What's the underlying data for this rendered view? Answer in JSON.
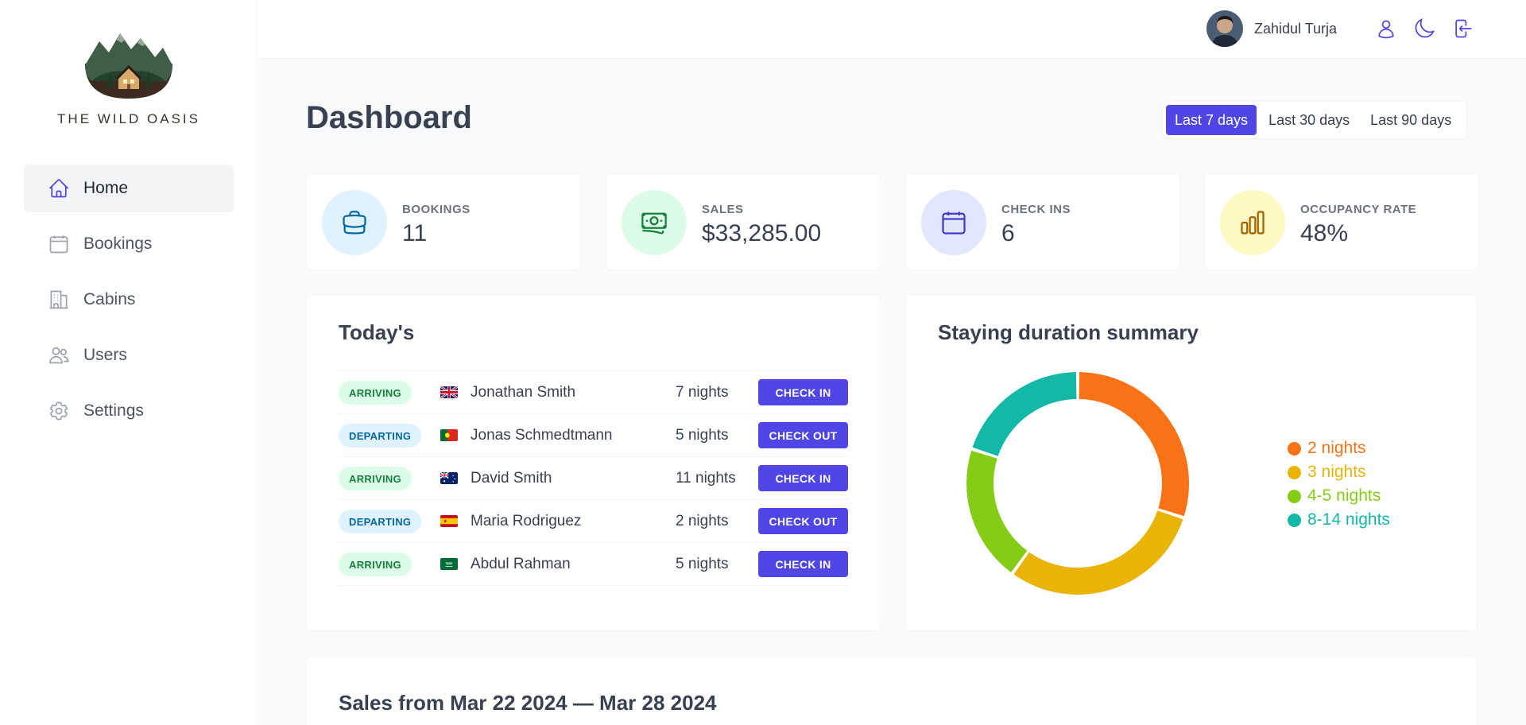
{
  "brand": {
    "name": "THE WILD OASIS"
  },
  "sidebar": {
    "items": [
      {
        "label": "Home",
        "icon": "home-icon",
        "active": true
      },
      {
        "label": "Bookings",
        "icon": "calendar-icon"
      },
      {
        "label": "Cabins",
        "icon": "building-icon"
      },
      {
        "label": "Users",
        "icon": "users-icon"
      },
      {
        "label": "Settings",
        "icon": "gear-icon"
      }
    ]
  },
  "header": {
    "user_name": "Zahidul Turja",
    "icons": [
      "user-icon",
      "moon-icon",
      "logout-icon"
    ]
  },
  "page": {
    "title": "Dashboard"
  },
  "filter": {
    "options": [
      "Last 7 days",
      "Last 30 days",
      "Last 90 days"
    ],
    "selected": "Last 7 days"
  },
  "stats": [
    {
      "label": "BOOKINGS",
      "value": "11",
      "icon": "briefcase-icon",
      "color": "#0369a1",
      "bg": "#e0f2fe"
    },
    {
      "label": "SALES",
      "value": "$33,285.00",
      "icon": "banknotes-icon",
      "color": "#15803d",
      "bg": "#dcfce7"
    },
    {
      "label": "CHECK INS",
      "value": "6",
      "icon": "calendar-days-icon",
      "color": "#4338ca",
      "bg": "#e0e7ff"
    },
    {
      "label": "OCCUPANCY RATE",
      "value": "48%",
      "icon": "chart-bar-icon",
      "color": "#a16207",
      "bg": "#fef9c3"
    }
  ],
  "today": {
    "title": "Today's",
    "rows": [
      {
        "status": "ARRIVING",
        "flag": "gb",
        "guest": "Jonathan Smith",
        "nights": "7 nights",
        "action": "CHECK IN"
      },
      {
        "status": "DEPARTING",
        "flag": "pt",
        "guest": "Jonas Schmedtmann",
        "nights": "5 nights",
        "action": "CHECK OUT"
      },
      {
        "status": "ARRIVING",
        "flag": "au",
        "guest": "David Smith",
        "nights": "11 nights",
        "action": "CHECK IN"
      },
      {
        "status": "DEPARTING",
        "flag": "es",
        "guest": "Maria Rodriguez",
        "nights": "2 nights",
        "action": "CHECK OUT"
      },
      {
        "status": "ARRIVING",
        "flag": "sa",
        "guest": "Abdul Rahman",
        "nights": "5 nights",
        "action": "CHECK IN"
      }
    ]
  },
  "duration": {
    "title": "Staying duration summary"
  },
  "chart_data": {
    "type": "pie",
    "categories": [
      "2 nights",
      "3 nights",
      "4-5 nights",
      "8-14 nights"
    ],
    "values": [
      3,
      3,
      2,
      2
    ],
    "colors": [
      "#f97316",
      "#eab308",
      "#84cc16",
      "#14b8a6"
    ],
    "legend": "right"
  },
  "sales": {
    "title": "Sales from Mar 22 2024 — Mar 28 2024"
  },
  "colors": {
    "accent": "#4f46e5",
    "background": "#f9fafb"
  }
}
